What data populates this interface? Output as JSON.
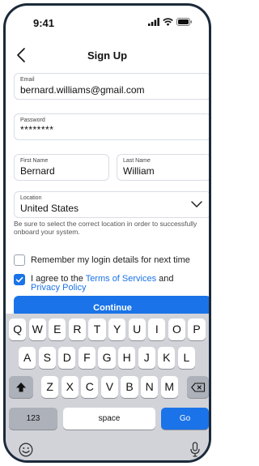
{
  "status": {
    "time": "9:41"
  },
  "nav": {
    "title": "Sign Up"
  },
  "form": {
    "email": {
      "label": "Email",
      "value": "bernard.williams@gmail.com"
    },
    "password": {
      "label": "Password",
      "value": "********"
    },
    "first_name": {
      "label": "First Name",
      "value": "Bernard"
    },
    "last_name": {
      "label": "Last Name",
      "value": "William"
    },
    "location": {
      "label": "Location",
      "value": "United States"
    },
    "location_helper": "Be sure to select the correct location in order to successfully onboard your system.",
    "remember": {
      "label": "Remember my login details for next time",
      "checked": false
    },
    "terms": {
      "prefix": "I agree to the ",
      "terms_link": "Terms of Services",
      "middle": " and ",
      "privacy_link": "Privacy Policy",
      "checked": true
    },
    "continue_label": "Continue"
  },
  "keyboard": {
    "row1": [
      "Q",
      "W",
      "E",
      "R",
      "T",
      "Y",
      "U",
      "I",
      "O",
      "P"
    ],
    "row2": [
      "A",
      "S",
      "D",
      "F",
      "G",
      "H",
      "J",
      "K",
      "L"
    ],
    "row3": [
      "Z",
      "X",
      "C",
      "V",
      "B",
      "N",
      "M"
    ],
    "numbers_label": "123",
    "space_label": "space",
    "go_label": "Go"
  },
  "colors": {
    "accent": "#1a73e8",
    "keyboard_bg": "#d1d3d9"
  },
  "icons": [
    "signal-icon",
    "wifi-icon",
    "battery-icon",
    "back-chevron-icon",
    "chevron-down-icon",
    "shift-icon",
    "backspace-icon",
    "emoji-icon",
    "microphone-icon"
  ]
}
